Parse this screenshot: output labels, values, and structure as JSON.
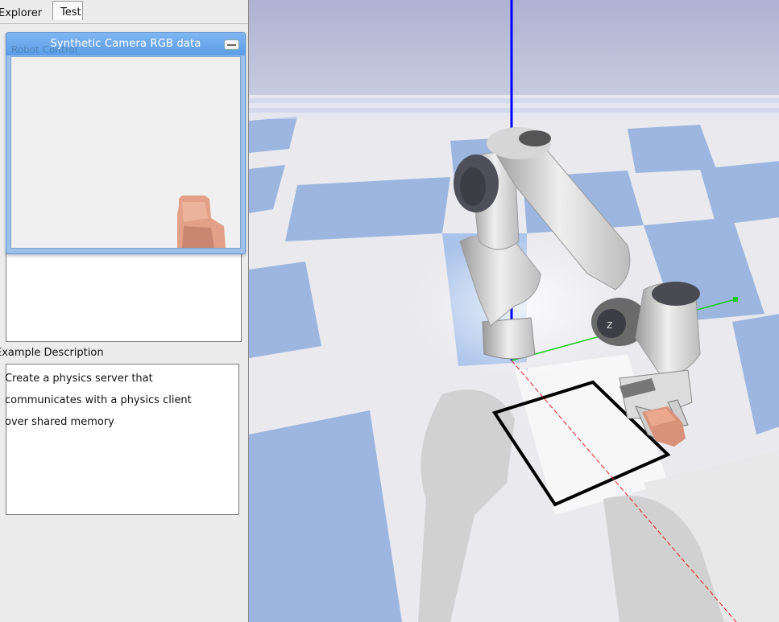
{
  "tabs": {
    "explorer_label": "Explorer",
    "test_label": "Test"
  },
  "example_description": {
    "label": "Example Description",
    "lines": [
      "Create a physics server that",
      "communicates with a physics client",
      "over shared memory"
    ]
  },
  "camera_window": {
    "title": "Synthetic Camera RGB data",
    "ghost_text": "Robot Control",
    "minimize_icon": "minimize-icon"
  },
  "colors": {
    "sky": "#b3b6d4",
    "floor_light": "#f2f2f2",
    "floor_blue": "#99b4de",
    "axis_z": "#0000ff",
    "axis_x": "#ff0000",
    "axis_y": "#00cc00",
    "title_blue": "#5b9de6",
    "object": "#d9927a"
  }
}
